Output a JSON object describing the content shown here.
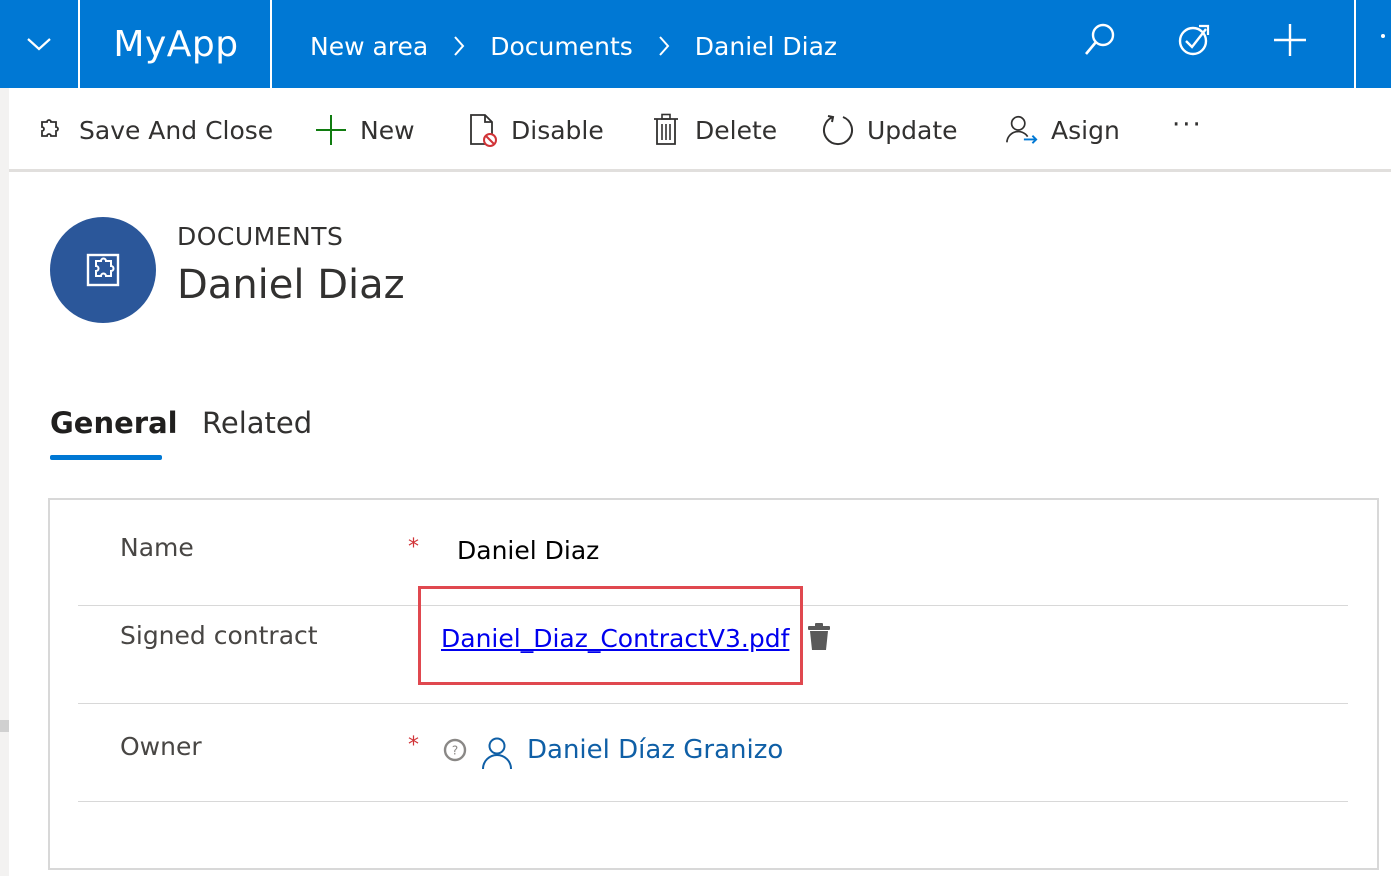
{
  "topbar": {
    "app_title": "MyApp",
    "breadcrumb": [
      "New area",
      "Documents",
      "Daniel Diaz"
    ],
    "icons": [
      "search-icon",
      "task-icon",
      "plus-icon"
    ],
    "accent": "#0078d4"
  },
  "commands": [
    {
      "label": "Save And Close",
      "icon": "save-close-icon"
    },
    {
      "label": "New",
      "icon": "plus-icon"
    },
    {
      "label": "Disable",
      "icon": "disable-icon"
    },
    {
      "label": "Delete",
      "icon": "trash-icon"
    },
    {
      "label": "Update",
      "icon": "refresh-icon"
    },
    {
      "label": "Asign",
      "icon": "assign-icon"
    }
  ],
  "more_label": "···",
  "record": {
    "entity": "DOCUMENTS",
    "title": "Daniel Diaz",
    "avatar_color": "#2b579a"
  },
  "tabs": [
    {
      "label": "General",
      "active": true
    },
    {
      "label": "Related",
      "active": false
    }
  ],
  "form": {
    "name_label": "Name",
    "name_value": "Daniel Diaz",
    "contract_label": "Signed contract",
    "contract_file": "Daniel_Diaz_ContractV3.pdf",
    "owner_label": "Owner",
    "owner_value": "Daniel Díaz Granizo",
    "required_mark": "*"
  }
}
